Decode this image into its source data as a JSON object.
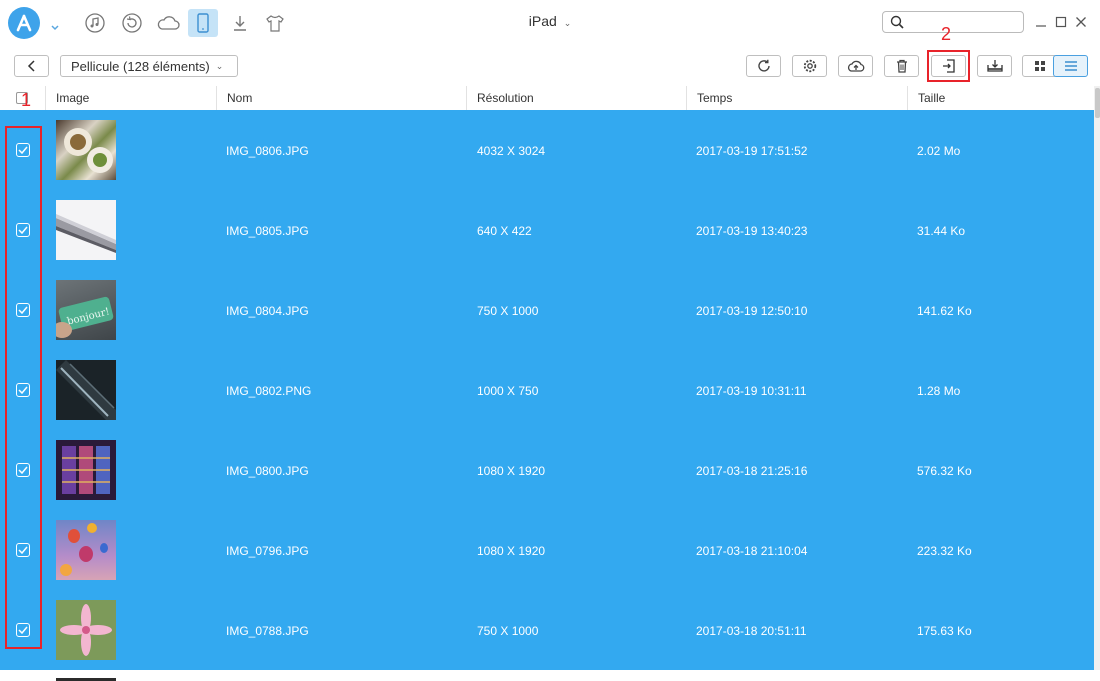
{
  "app": {
    "device_title": "iPad"
  },
  "toolbar": {
    "album_label": "Pellicule (128 éléments)"
  },
  "table": {
    "headers": [
      "Image",
      "Nom",
      "Résolution",
      "Temps",
      "Taille"
    ],
    "rows": [
      {
        "name": "IMG_0806.JPG",
        "resolution": "4032 X 3024",
        "time": "2017-03-19 17:51:52",
        "size": "2.02 Mo",
        "thumb_icon": "food-plates-photo"
      },
      {
        "name": "IMG_0805.JPG",
        "resolution": "640 X 422",
        "time": "2017-03-19 13:40:23",
        "size": "31.44 Ko",
        "thumb_icon": "laptop-edge-photo"
      },
      {
        "name": "IMG_0804.JPG",
        "resolution": "750 X 1000",
        "time": "2017-03-19 12:50:10",
        "size": "141.62 Ko",
        "thumb_icon": "bonjour-card-photo"
      },
      {
        "name": "IMG_0802.PNG",
        "resolution": "1000 X 750",
        "time": "2017-03-19 10:31:11",
        "size": "1.28 Mo",
        "thumb_icon": "dark-device-photo"
      },
      {
        "name": "IMG_0800.JPG",
        "resolution": "1080 X 1920",
        "time": "2017-03-18 21:25:16",
        "size": "576.32 Ko",
        "thumb_icon": "stained-glass-photo"
      },
      {
        "name": "IMG_0796.JPG",
        "resolution": "1080 X 1920",
        "time": "2017-03-18 21:10:04",
        "size": "223.32 Ko",
        "thumb_icon": "hot-air-balloons-photo"
      },
      {
        "name": "IMG_0788.JPG",
        "resolution": "750 X 1000",
        "time": "2017-03-18 20:51:11",
        "size": "175.63 Ko",
        "thumb_icon": "pink-lily-photo"
      }
    ]
  },
  "annotations": {
    "label_1": "1",
    "label_2": "2"
  },
  "colors": {
    "selected_row": "#33a9f0",
    "accent": "#3ea3ea",
    "annotation": "#e8232a"
  }
}
